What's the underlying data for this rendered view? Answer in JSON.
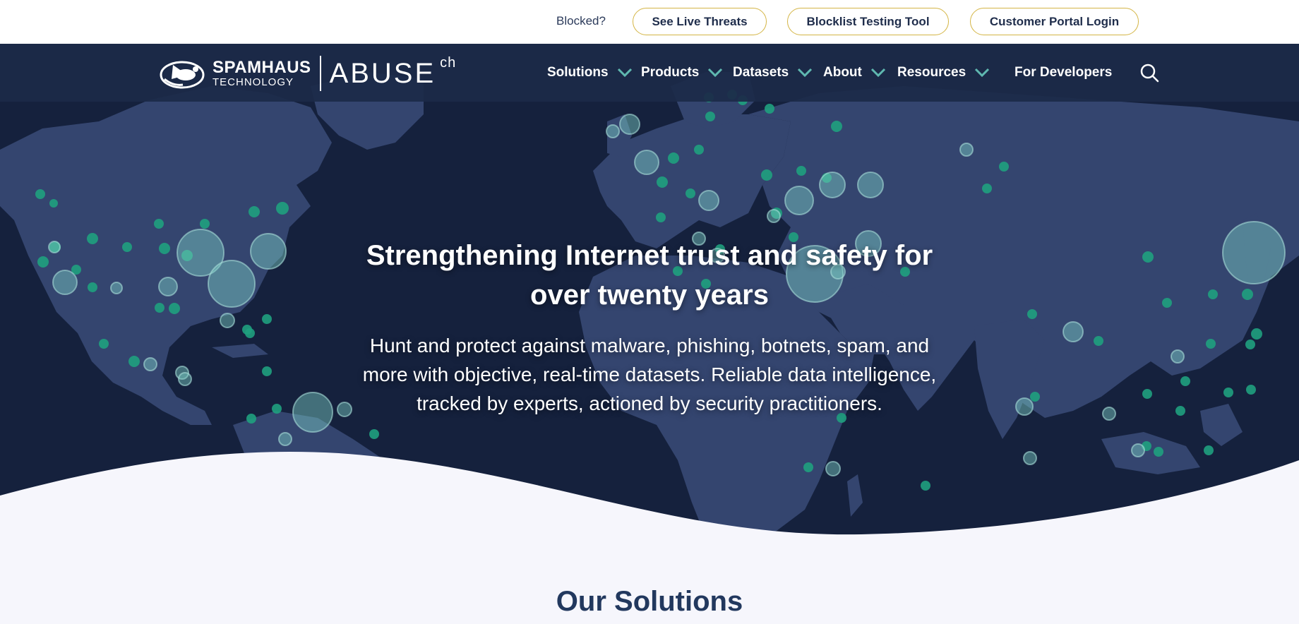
{
  "topbar": {
    "blocked_label": "Blocked?",
    "buttons": {
      "live_threats": "See Live Threats",
      "blocklist_tool": "Blocklist Testing Tool",
      "portal_login": "Customer Portal Login"
    }
  },
  "brand": {
    "spamhaus": "SPAMHAUS",
    "technology": "TECHNOLOGY",
    "abuse": "ABUSE",
    "ch": "ch"
  },
  "nav": {
    "items": [
      {
        "label": "Solutions",
        "dropdown": true
      },
      {
        "label": "Products",
        "dropdown": true
      },
      {
        "label": "Datasets",
        "dropdown": true
      },
      {
        "label": "About",
        "dropdown": true
      },
      {
        "label": "Resources",
        "dropdown": true
      },
      {
        "label": "For Developers",
        "dropdown": false
      }
    ],
    "search_icon": "search-icon"
  },
  "hero": {
    "title_lines": [
      "Strengthening Internet trust and safety for",
      "over twenty years"
    ],
    "subtitle_lines": [
      "Hunt and protect against malware, phishing, botnets, spam, and",
      "more with objective, real-time datasets. Reliable data intelligence,",
      "tracked by experts, actioned by security practitioners."
    ]
  },
  "section": {
    "title": "Our Solutions"
  },
  "colors": {
    "navy": "#1c2a48",
    "map_land": "#34456f",
    "dot_green": "#1fa07e",
    "dot_light": "#6fc3bb",
    "pill_border": "#d4b545",
    "chevron": "#5fb8b0",
    "page_bg": "#f6f6fc"
  }
}
